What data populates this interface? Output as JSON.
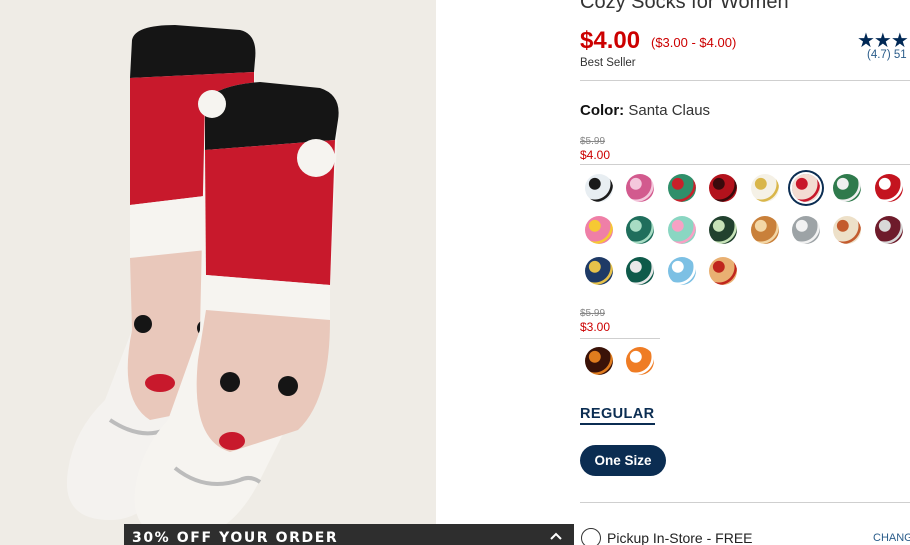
{
  "product": {
    "title": "Cozy Socks for Women",
    "price": "$4.00",
    "price_range": "($3.00 - $4.00)",
    "badge": "Best Seller",
    "rating_stars": "★★★",
    "rating_text": "(4.7) 51"
  },
  "color": {
    "label": "Color:",
    "value": "Santa Claus"
  },
  "price_groups": [
    {
      "old_price": "$5.99",
      "new_price": "$4.00"
    },
    {
      "old_price": "$5.99",
      "new_price": "$3.00"
    }
  ],
  "swatches": [
    {
      "name": "penguin",
      "color": "#e8eef2",
      "accent": "#1a1a1a"
    },
    {
      "name": "floral-pink",
      "color": "#d25a8e",
      "accent": "#f4c7dc"
    },
    {
      "name": "striped-green",
      "color": "#2f8f6a",
      "accent": "#c8202a"
    },
    {
      "name": "red-plaid",
      "color": "#b3121c",
      "accent": "#3a0a0c"
    },
    {
      "name": "polar-bear",
      "color": "#f5f1e6",
      "accent": "#d9b64a"
    },
    {
      "name": "santa-claus",
      "color": "#f3dcd2",
      "accent": "#c8172a",
      "selected": true
    },
    {
      "name": "patterned-green",
      "color": "#2f7a4c",
      "accent": "#f0f0f0"
    },
    {
      "name": "red-dots",
      "color": "#c4141f",
      "accent": "#ffffff"
    },
    {
      "name": "letters-pink",
      "color": "#ef7fa7",
      "accent": "#f6c933"
    },
    {
      "name": "cactus-green",
      "color": "#1f6e5c",
      "accent": "#a8dcc4"
    },
    {
      "name": "unicorn-mint",
      "color": "#8ad6c2",
      "accent": "#f7a1c4"
    },
    {
      "name": "dark-forest",
      "color": "#21412e",
      "accent": "#c7e3b8"
    },
    {
      "name": "waffle-tan",
      "color": "#c9803a",
      "accent": "#f3d7a6"
    },
    {
      "name": "raccoon-grey",
      "color": "#9da3a6",
      "accent": "#f2f2f2"
    },
    {
      "name": "llama-beige",
      "color": "#ede0c8",
      "accent": "#c35b2e"
    },
    {
      "name": "maroon-stripe",
      "color": "#6e1b2b",
      "accent": "#d8d8d8"
    },
    {
      "name": "navy-print",
      "color": "#1e3a66",
      "accent": "#e7c24a"
    },
    {
      "name": "teal-print",
      "color": "#0e5a4a",
      "accent": "#e8e8e8"
    },
    {
      "name": "ice-blue",
      "color": "#7cc0e4",
      "accent": "#ffffff"
    },
    {
      "name": "pizza",
      "color": "#e9b072",
      "accent": "#c0261d"
    },
    {
      "name": "dark-orange-print",
      "color": "#3a1208",
      "accent": "#e07c1e"
    },
    {
      "name": "fox-orange",
      "color": "#ef7c24",
      "accent": "#ffffff"
    }
  ],
  "fit": {
    "tab_label": "REGULAR",
    "size_label": "One Size"
  },
  "fulfillment": {
    "pickup_label": "Pickup In-Store - FREE",
    "change_label": "CHANGE"
  },
  "promo": {
    "text": "30% OFF YOUR ORDER"
  },
  "colors": {
    "price_red": "#cc0000",
    "navy": "#0b2d52",
    "promo_bg": "#2e2e2e"
  }
}
